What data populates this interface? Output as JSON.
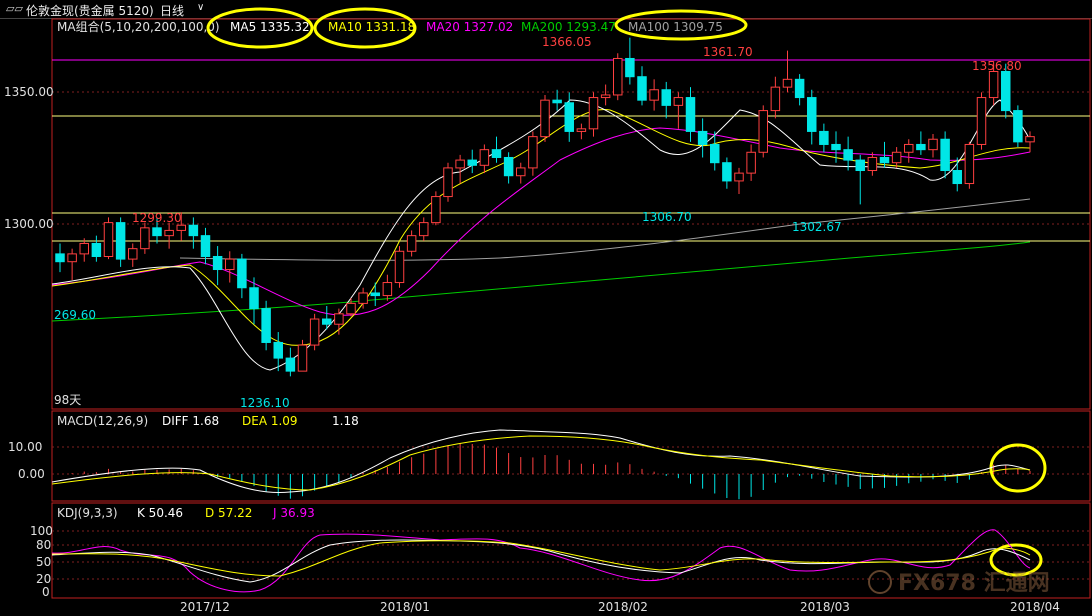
{
  "window": {
    "title": "伦敦金现(贵金属 5120)",
    "period": "日线",
    "period_arrow": "∨"
  },
  "legend_main": {
    "label": "MA组合(5,10,20,200,100,0)",
    "ma5": "MA5 1335.32",
    "ma10": "MA10 1331.18",
    "ma20": "MA20 1327.02",
    "ma200": "MA200 1293.47",
    "ma100": "MA100 1309.75"
  },
  "legend_macd": {
    "label": "MACD(12,26,9)",
    "diff": "DIFF  1.68",
    "dea": "DEA  1.09",
    "macd": "1.18"
  },
  "legend_kdj": {
    "label": "KDJ(9,3,3)",
    "k": "K  50.46",
    "d": "D  57.22",
    "j": "J  36.93"
  },
  "y_labels_main": [
    "1350.00",
    "1300.00"
  ],
  "y_labels_macd": [
    "10.00",
    "0.00"
  ],
  "y_labels_kdj": [
    "100",
    "80",
    "50",
    "20",
    "0"
  ],
  "annotations": {
    "high1": "1366.05",
    "high2": "1361.70",
    "high3": "1356.80",
    "high0": "1299.30",
    "low1": "1236.10",
    "low2": "1306.70",
    "low3": "1302.67",
    "left_value": "269.60",
    "days": "98天"
  },
  "x_labels": [
    "2017/12",
    "2018/01",
    "2018/02",
    "2018/03",
    "2018/04"
  ],
  "watermark": "FX678 汇通网",
  "colors": {
    "up": "#ff4040",
    "down": "#00e6e6",
    "ma5": "#ffffff",
    "ma10": "#ffff00",
    "ma20": "#ff00ff",
    "ma200": "#00cc00",
    "ma100": "#a0a0a0",
    "highlight": "#ffff00"
  },
  "chart_data": {
    "type": "candlestick",
    "ylim": [
      1225,
      1372
    ],
    "candles": [
      [
        1283,
        1287,
        1276,
        1280
      ],
      [
        1280,
        1285,
        1273,
        1283
      ],
      [
        1283,
        1289,
        1280,
        1287
      ],
      [
        1287,
        1290,
        1280,
        1282
      ],
      [
        1282,
        1297,
        1281,
        1295
      ],
      [
        1295,
        1297,
        1278,
        1281
      ],
      [
        1281,
        1287,
        1278,
        1285
      ],
      [
        1285,
        1295,
        1283,
        1293
      ],
      [
        1293,
        1297,
        1287,
        1290
      ],
      [
        1290,
        1295,
        1285,
        1292
      ],
      [
        1292,
        1299,
        1288,
        1294
      ],
      [
        1294,
        1297,
        1285,
        1290
      ],
      [
        1290,
        1293,
        1279,
        1282
      ],
      [
        1282,
        1286,
        1271,
        1277
      ],
      [
        1277,
        1284,
        1272,
        1281
      ],
      [
        1281,
        1283,
        1266,
        1270
      ],
      [
        1270,
        1274,
        1256,
        1262
      ],
      [
        1262,
        1265,
        1246,
        1249
      ],
      [
        1249,
        1253,
        1238,
        1243
      ],
      [
        1243,
        1247,
        1236,
        1238
      ],
      [
        1238,
        1250,
        1238,
        1248
      ],
      [
        1248,
        1260,
        1246,
        1258
      ],
      [
        1258,
        1263,
        1254,
        1256
      ],
      [
        1256,
        1262,
        1252,
        1260
      ],
      [
        1260,
        1266,
        1259,
        1264
      ],
      [
        1264,
        1270,
        1262,
        1268
      ],
      [
        1268,
        1272,
        1263,
        1267
      ],
      [
        1267,
        1275,
        1265,
        1272
      ],
      [
        1272,
        1286,
        1270,
        1284
      ],
      [
        1284,
        1292,
        1282,
        1290
      ],
      [
        1290,
        1297,
        1288,
        1295
      ],
      [
        1295,
        1307,
        1294,
        1305
      ],
      [
        1305,
        1318,
        1303,
        1316
      ],
      [
        1316,
        1321,
        1310,
        1319
      ],
      [
        1319,
        1323,
        1314,
        1317
      ],
      [
        1317,
        1325,
        1314,
        1323
      ],
      [
        1323,
        1328,
        1318,
        1320
      ],
      [
        1320,
        1322,
        1310,
        1313
      ],
      [
        1313,
        1318,
        1310,
        1316
      ],
      [
        1316,
        1330,
        1313,
        1328
      ],
      [
        1328,
        1344,
        1326,
        1342
      ],
      [
        1342,
        1346,
        1338,
        1341
      ],
      [
        1341,
        1345,
        1326,
        1330
      ],
      [
        1330,
        1333,
        1327,
        1331
      ],
      [
        1331,
        1345,
        1328,
        1343
      ],
      [
        1343,
        1348,
        1340,
        1344
      ],
      [
        1344,
        1360,
        1342,
        1358
      ],
      [
        1358,
        1366,
        1348,
        1351
      ],
      [
        1351,
        1355,
        1340,
        1342
      ],
      [
        1342,
        1350,
        1338,
        1346
      ],
      [
        1346,
        1349,
        1335,
        1340
      ],
      [
        1340,
        1345,
        1331,
        1343
      ],
      [
        1343,
        1347,
        1326,
        1330
      ],
      [
        1330,
        1335,
        1320,
        1325
      ],
      [
        1325,
        1330,
        1315,
        1318
      ],
      [
        1318,
        1320,
        1308,
        1311
      ],
      [
        1311,
        1316,
        1306,
        1314
      ],
      [
        1314,
        1325,
        1311,
        1322
      ],
      [
        1322,
        1340,
        1320,
        1338
      ],
      [
        1338,
        1351,
        1335,
        1347
      ],
      [
        1347,
        1361,
        1345,
        1350
      ],
      [
        1350,
        1352,
        1340,
        1343
      ],
      [
        1343,
        1346,
        1325,
        1330
      ],
      [
        1330,
        1333,
        1322,
        1325
      ],
      [
        1325,
        1330,
        1318,
        1323
      ],
      [
        1323,
        1328,
        1315,
        1319
      ],
      [
        1319,
        1321,
        1302,
        1315
      ],
      [
        1315,
        1322,
        1313,
        1320
      ],
      [
        1320,
        1326,
        1316,
        1318
      ],
      [
        1318,
        1324,
        1316,
        1322
      ],
      [
        1322,
        1327,
        1318,
        1325
      ],
      [
        1325,
        1330,
        1321,
        1323
      ],
      [
        1323,
        1329,
        1320,
        1327
      ],
      [
        1327,
        1330,
        1312,
        1315
      ],
      [
        1315,
        1320,
        1307,
        1310
      ],
      [
        1310,
        1326,
        1308,
        1325
      ],
      [
        1325,
        1345,
        1323,
        1343
      ],
      [
        1343,
        1357,
        1340,
        1353
      ],
      [
        1353,
        1356,
        1335,
        1338
      ],
      [
        1338,
        1340,
        1324,
        1326
      ],
      [
        1326,
        1330,
        1322,
        1328
      ]
    ]
  }
}
